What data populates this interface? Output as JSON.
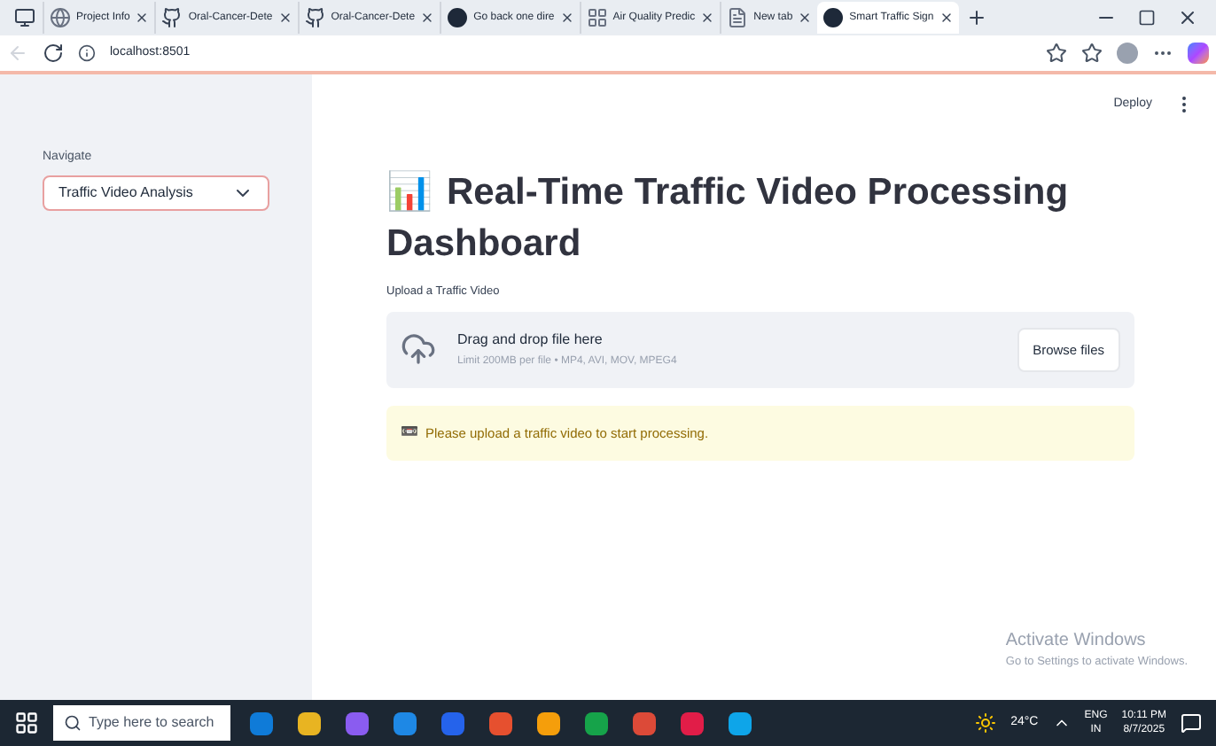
{
  "browser": {
    "tabs": [
      {
        "label": "Project Info",
        "selected": false,
        "kind": "globe"
      },
      {
        "label": "Oral-Cancer-Dete",
        "selected": false,
        "kind": "github"
      },
      {
        "label": "Oral-Cancer-Dete",
        "selected": false,
        "kind": "github"
      },
      {
        "label": "Go back one dire",
        "selected": false,
        "kind": "dot"
      },
      {
        "label": "Air Quality Predic",
        "selected": false,
        "kind": "grid"
      },
      {
        "label": "New tab",
        "selected": false,
        "kind": "page"
      },
      {
        "label": "Smart Traffic Sign",
        "selected": true,
        "kind": "dot"
      }
    ],
    "address": "localhost:8501"
  },
  "sidebar": {
    "label": "Navigate",
    "select_value": "Traffic Video Analysis"
  },
  "header": {
    "deploy": "Deploy"
  },
  "main": {
    "title_icon": "📊",
    "title": "Real-Time Traffic Video Processing Dashboard",
    "uploader": {
      "label": "Upload a Traffic Video",
      "drop_text": "Drag and drop file here",
      "limit": "Limit 200MB per file • MP4, AVI, MOV, MPEG4",
      "button": "Browse files"
    },
    "alert": {
      "icon": "📼",
      "text": "Please upload a traffic video to start processing."
    }
  },
  "activation": {
    "title": "Activate Windows",
    "subtitle": "Go to Settings to activate Windows."
  },
  "taskbar": {
    "search_placeholder": "Type here to search",
    "apps": [
      {
        "color": "#0f7bd8"
      },
      {
        "color": "#e8b422"
      },
      {
        "color": "#8a5cf0"
      },
      {
        "color": "#1e88e5"
      },
      {
        "color": "#2563eb"
      },
      {
        "color": "#e6502f"
      },
      {
        "color": "#f59e0b"
      },
      {
        "color": "#16a34a"
      },
      {
        "color": "#dc4a38"
      },
      {
        "color": "#e11d48"
      },
      {
        "color": "#0ea5e9"
      }
    ],
    "weather": "24°C",
    "lang": "ENG",
    "region": "IN",
    "time": "10:11 PM",
    "date": "8/7/2025"
  }
}
